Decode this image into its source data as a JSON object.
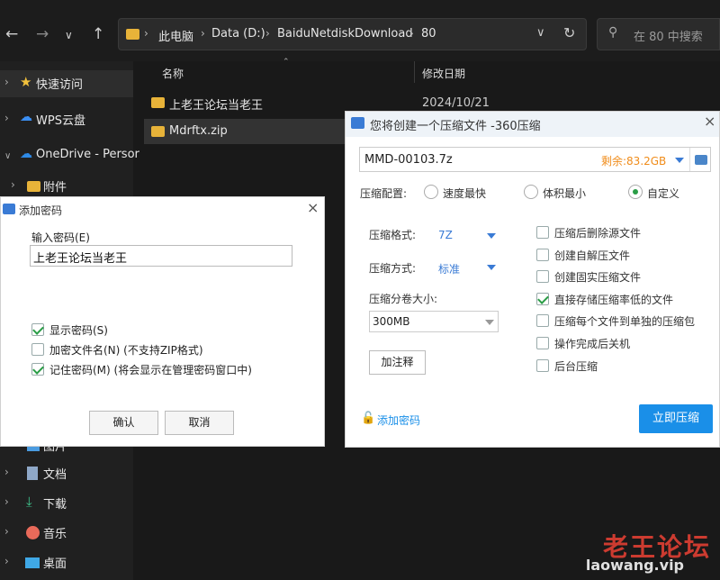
{
  "explorer": {
    "breadcrumb": [
      "此电脑",
      "Data (D:)",
      "BaiduNetdiskDownload",
      "80"
    ],
    "search_placeholder": "在 80 中搜索",
    "sidebar": [
      {
        "label": "快速访问"
      },
      {
        "label": "WPS云盘"
      },
      {
        "label": "OneDrive - Persor"
      },
      {
        "label": "附件"
      },
      {
        "label": "图片"
      },
      {
        "label": "文档"
      },
      {
        "label": "下载"
      },
      {
        "label": "音乐"
      },
      {
        "label": "桌面"
      }
    ],
    "columns": {
      "name": "名称",
      "date": "修改日期"
    },
    "files": [
      {
        "name": "上老王论坛当老王",
        "date": "2024/10/21"
      },
      {
        "name": "Mdrftx.zip",
        "date": ""
      }
    ]
  },
  "password_dialog": {
    "title": "添加密码",
    "input_label": "输入密码(E)",
    "input_value": "上老王论坛当老王",
    "options": [
      {
        "label": "显示密码(S)",
        "checked": true
      },
      {
        "label": "加密文件名(N) (不支持ZIP格式)",
        "checked": false
      },
      {
        "label": "记住密码(M) (将会显示在管理密码窗口中)",
        "checked": true
      }
    ],
    "ok": "确认",
    "cancel": "取消"
  },
  "compress_dialog": {
    "title": "您将创建一个压缩文件 -360压缩",
    "filename": "MMD-00103.7z",
    "free_space": "剩余:83.2GB",
    "config_label": "压缩配置:",
    "config_options": [
      {
        "label": "速度最快",
        "selected": false
      },
      {
        "label": "体积最小",
        "selected": false
      },
      {
        "label": "自定义",
        "selected": true
      }
    ],
    "format_label": "压缩格式:",
    "format_value": "7Z",
    "method_label": "压缩方式:",
    "method_value": "标准",
    "volume_label": "压缩分卷大小:",
    "volume_value": "300MB",
    "comment_button": "加注释",
    "options": [
      {
        "label": "压缩后删除源文件",
        "checked": false
      },
      {
        "label": "创建自解压文件",
        "checked": false
      },
      {
        "label": "创建固实压缩文件",
        "checked": false
      },
      {
        "label": "直接存储压缩率低的文件",
        "checked": true
      },
      {
        "label": "压缩每个文件到单独的压缩包",
        "checked": false
      },
      {
        "label": "操作完成后关机",
        "checked": false
      },
      {
        "label": "后台压缩",
        "checked": false
      }
    ],
    "add_password": "添加密码",
    "start_button": "立即压缩"
  },
  "watermark": {
    "name": "老王论坛",
    "url": "laowang.vip"
  },
  "colors": {
    "accent": "#1a8fe8",
    "folder": "#e8b339",
    "warning": "#f08c1a",
    "check": "#2a9d46"
  }
}
